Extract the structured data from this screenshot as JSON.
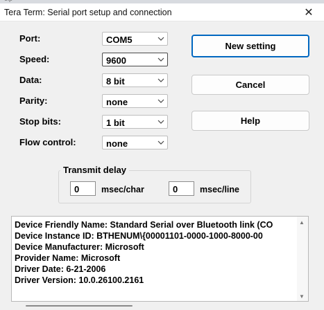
{
  "window": {
    "background_caption": "elp",
    "title": "Tera Term: Serial port setup and connection",
    "close_glyph": "✕"
  },
  "fields": [
    {
      "label": "Port:",
      "value": "COM5"
    },
    {
      "label": "Speed:",
      "value": "9600"
    },
    {
      "label": "Data:",
      "value": "8 bit"
    },
    {
      "label": "Parity:",
      "value": "none"
    },
    {
      "label": "Stop bits:",
      "value": "1 bit"
    },
    {
      "label": "Flow control:",
      "value": "none"
    }
  ],
  "buttons": {
    "new_setting": "New setting",
    "cancel": "Cancel",
    "help": "Help"
  },
  "transmit_delay": {
    "title": "Transmit delay",
    "char_value": "0",
    "char_unit": "msec/char",
    "line_value": "0",
    "line_unit": "msec/line"
  },
  "device_info": [
    "Device Friendly Name: Standard Serial over Bluetooth link (CO",
    "Device Instance ID: BTHENUM\\{00001101-0000-1000-8000-00",
    "Device Manufacturer: Microsoft",
    "Provider Name: Microsoft",
    "Driver Date: 6-21-2006",
    "Driver Version: 10.0.26100.2161"
  ],
  "colors": {
    "accent": "#0067c0",
    "dialog_bg": "#f0f0f0"
  }
}
